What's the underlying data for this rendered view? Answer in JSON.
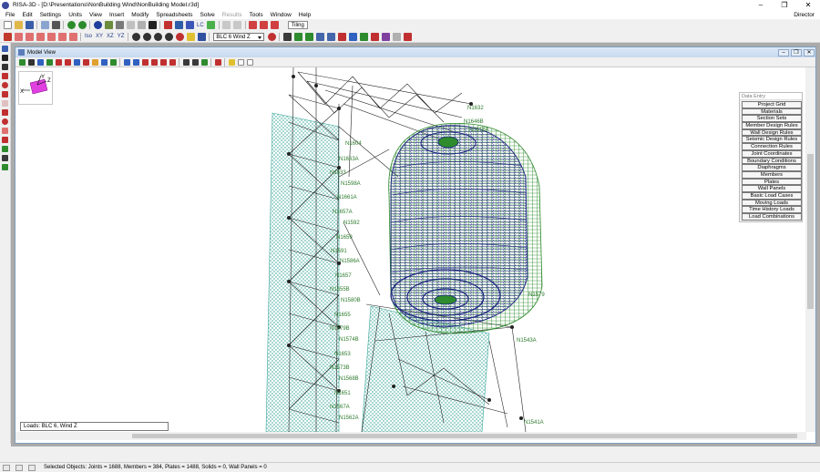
{
  "window": {
    "title": "RISA-3D - [D:\\Presentations\\NonBuilding Wind\\NonBuilding Model.r3d]",
    "controls": [
      "–",
      "❐",
      "✕"
    ]
  },
  "menu": {
    "items": [
      "File",
      "Edit",
      "Settings",
      "Units",
      "View",
      "Insert",
      "Modify",
      "Spreadsheets",
      "Solve",
      "Results",
      "Tools",
      "Window",
      "Help"
    ],
    "disabled": "Results",
    "user": "Director"
  },
  "toolbar1": {
    "tiling_label": "Tiling",
    "lc_label": "LC"
  },
  "toolbar2": {
    "view_iso": "Iso",
    "view_xy": "XY",
    "view_xz": "XZ",
    "view_yz": "YZ",
    "load_combo_selected": "BLC 6 Wind Z"
  },
  "model_view": {
    "title": "Model View",
    "loads_text": "Loads: BLC 6, Wind Z",
    "axis": {
      "x": "X",
      "y": "Y",
      "z": "Z"
    }
  },
  "data_entry": {
    "title": "Data Entry",
    "items": [
      "Project Grid",
      "Materials",
      "Section Sets",
      "Member Design Rules",
      "Wall Design Rules",
      "Seismic Design Rules",
      "Connection Rules",
      "Joint Coordinates",
      "Boundary Conditions",
      "Diaphragms",
      "Members",
      "Plates",
      "Wall Panels",
      "Basic Load Cases",
      "Moving Loads",
      "Time History Loads",
      "Load Combinations"
    ]
  },
  "joint_labels": {
    "n1632": "N1632",
    "n1646b": "N1646B",
    "n1616a": "N1616A",
    "n1604": "N1604",
    "n1663a": "N1663A",
    "n1633": "N1633",
    "n1598a": "N1598A",
    "n1661a": "N1661A",
    "n1657a": "N1657A",
    "n1592": "N1592",
    "n1659": "N1659",
    "n1591": "N1591",
    "n1586a": "N1586A",
    "n1657": "N1657",
    "n1655b": "N1655B",
    "n1580b": "N1580B",
    "n1655": "N1655",
    "n1579b": "N1579B",
    "n1574b": "N1574B",
    "n1653": "N1653",
    "n1573b": "N1573B",
    "n1568b": "N1568B",
    "n1651": "N1651",
    "n1567a": "N1567A",
    "n1562a": "N1562A",
    "n1543a": "N1543A",
    "n1541a": "N1541A",
    "n1579": "N1579"
  },
  "status": {
    "selected": "Selected Objects: Joints = 1688, Members = 384, Plates = 1488, Solids = 0, Wall Panels = 0"
  },
  "colors": {
    "mesh_green": "#2e8b2e",
    "mesh_navy": "#1a237e",
    "plate_teal": "#3aa69a",
    "joint_label": "#2c7a2c"
  }
}
